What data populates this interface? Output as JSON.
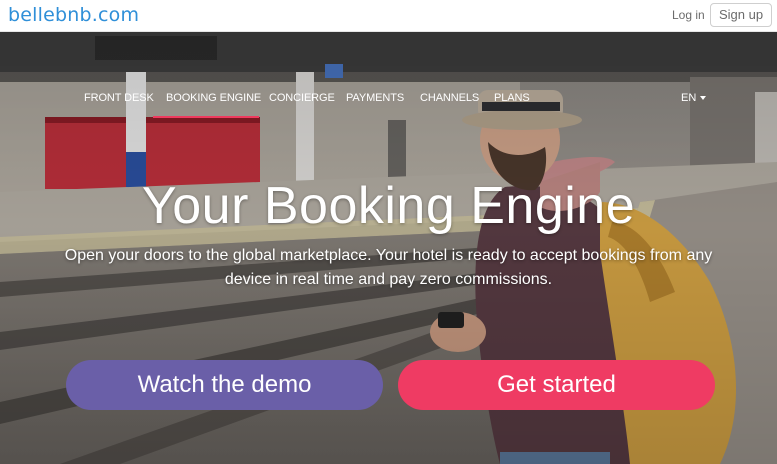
{
  "topbar": {
    "logo": "bellebnb.com",
    "login_label": "Log in",
    "signup_label": "Sign up"
  },
  "nav": {
    "items": [
      {
        "label": "FRONT DESK"
      },
      {
        "label": "BOOKING ENGINE",
        "active": true
      },
      {
        "label": "CONCIERGE"
      },
      {
        "label": "PAYMENTS"
      },
      {
        "label": "CHANNELS"
      },
      {
        "label": "PLANS"
      }
    ],
    "language": "EN"
  },
  "hero": {
    "headline": "Your Booking Engine",
    "subline": "Open your doors to the global marketplace. Your hotel is ready to accept bookings from any device in real time and pay zero commissions.",
    "demo_button": "Watch the demo",
    "start_button": "Get started"
  },
  "colors": {
    "brand_blue": "#2f8fd8",
    "demo_purple": "#6a5fa8",
    "start_pink": "#ef3b63",
    "active_underline": "#ef3b5e"
  }
}
